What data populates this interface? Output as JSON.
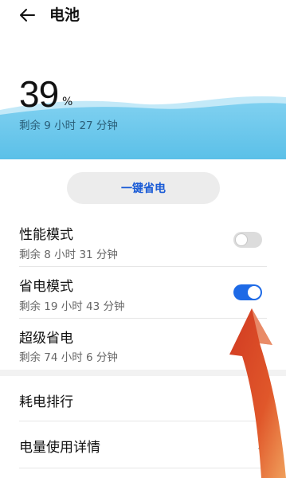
{
  "header": {
    "title": "电池",
    "back_icon": "arrow-left-icon"
  },
  "battery": {
    "level": "39",
    "unit": "%",
    "remaining": "剩余 9 小时 27 分钟",
    "wave_color": "#5bc0e8"
  },
  "saver_button": {
    "label": "一键省电"
  },
  "modes": [
    {
      "title": "性能模式",
      "subtitle": "剩余 8 小时 31 分钟",
      "enabled": false
    },
    {
      "title": "省电模式",
      "subtitle": "剩余 19 小时 43 分钟",
      "enabled": true
    },
    {
      "title": "超级省电",
      "subtitle": "剩余 74 小时 6 分钟"
    }
  ],
  "nav": [
    {
      "title": "耗电排行",
      "icon": "chevron-right-icon"
    },
    {
      "title": "电量使用详情",
      "icon": "chevron-right-icon"
    }
  ],
  "colors": {
    "accent": "#1e6ae6",
    "toggle_off": "#dcdcdc",
    "overlay_arrow": "#e0572a"
  }
}
